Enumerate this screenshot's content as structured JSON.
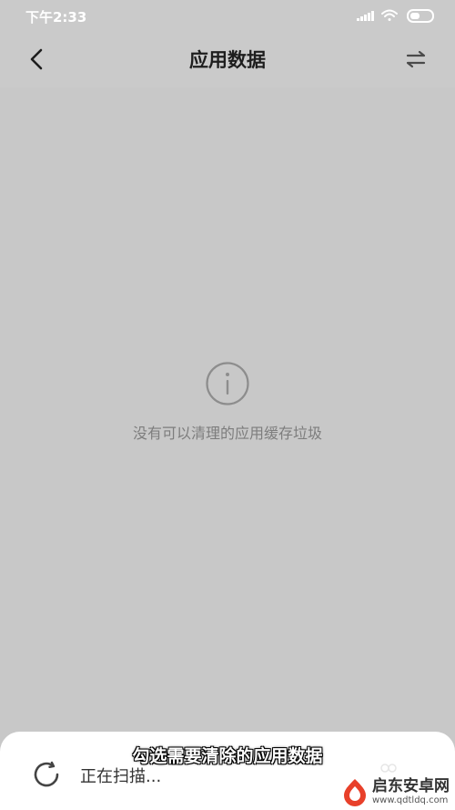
{
  "status_bar": {
    "time": "下午2:33",
    "icons": [
      "signal-icon",
      "wifi-icon",
      "battery-icon"
    ]
  },
  "header": {
    "title": "应用数据",
    "back_icon": "back-arrow-icon",
    "action_icon": "switch-arrows-icon"
  },
  "empty_state": {
    "icon": "info-icon",
    "message": "没有可以清理的应用缓存垃圾"
  },
  "bottom_sheet": {
    "status": "正在扫描...",
    "spinner_icon": "loading-spinner-icon"
  },
  "caption": "勾选需要清除的应用数据",
  "watermark": {
    "title": "启东安卓网",
    "url": "www.qdtldq.com"
  },
  "colors": {
    "overlay_background": "#c8c8c8",
    "sheet_background": "#ffffff",
    "watermark_accent": "#e8402a"
  }
}
